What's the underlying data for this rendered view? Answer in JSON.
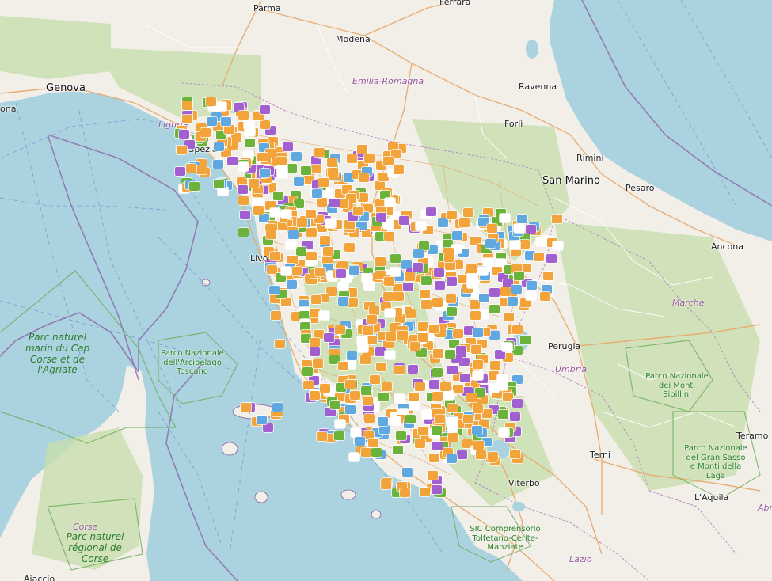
{
  "map": {
    "colors": {
      "sea": "#aad3df",
      "land": "#f2efe9",
      "forest": "#c8dfae",
      "park_border": "#66aa55",
      "admin_border": "#8b5fa6",
      "road_major": "#e8a86b",
      "road_minor": "#ffffff",
      "maritime_line": "#6f8fd0"
    },
    "marker_colors": {
      "orange": "#f2a33a",
      "purple": "#a25fd0",
      "green": "#6bb33a",
      "blue": "#5fa8e0",
      "white": "#ffffff"
    },
    "cities": [
      {
        "id": "parma",
        "name": "Parma"
      },
      {
        "id": "ferrara",
        "name": "Ferrara"
      },
      {
        "id": "genova",
        "name": "Genova"
      },
      {
        "id": "modena",
        "name": "Modena"
      },
      {
        "id": "ravenna",
        "name": "Ravenna"
      },
      {
        "id": "forli",
        "name": "Forlì"
      },
      {
        "id": "la-spezia",
        "name": "La Spezia"
      },
      {
        "id": "rimini",
        "name": "Rimini"
      },
      {
        "id": "san-marino",
        "name": "San Marino"
      },
      {
        "id": "pesaro",
        "name": "Pesaro"
      },
      {
        "id": "ancona",
        "name": "Ancona"
      },
      {
        "id": "livorno",
        "name": "Livorno"
      },
      {
        "id": "perugia",
        "name": "Perugia"
      },
      {
        "id": "terni",
        "name": "Terni"
      },
      {
        "id": "viterbo",
        "name": "Viterbo"
      },
      {
        "id": "teramo",
        "name": "Teramo"
      },
      {
        "id": "laquila",
        "name": "L'Aquila"
      },
      {
        "id": "ajaccio",
        "name": "Ajaccio"
      },
      {
        "id": "bastia-edge",
        "name": "ona"
      }
    ],
    "regions": [
      {
        "id": "emilia-romagna",
        "name": "Emilia-Romagna"
      },
      {
        "id": "liguria",
        "name": "Liguria"
      },
      {
        "id": "marche",
        "name": "Marche"
      },
      {
        "id": "umbria",
        "name": "Umbria"
      },
      {
        "id": "corse",
        "name": "Corse"
      },
      {
        "id": "lazio",
        "name": "Lazio"
      }
    ],
    "parks": [
      {
        "id": "cap-corse",
        "name": "Parc naturel marin du Cap Corse et de l'Agriate"
      },
      {
        "id": "arcipelago",
        "name": "Parco Nazionale dell'Arcipelago Toscano"
      },
      {
        "id": "sibillini",
        "name": "Parco Nazionale dei Monti Sibillini"
      },
      {
        "id": "gran-sasso",
        "name": "Parco Nazionale del Gran Sasso e Monti della Laga"
      },
      {
        "id": "corse-regional",
        "name": "Parc naturel régional de Corse"
      },
      {
        "id": "tolfetano",
        "name": "SIC Comprensorio Tolfetano-Cerite-Manziate"
      },
      {
        "id": "abr-edge",
        "name": "Abr"
      }
    ]
  }
}
